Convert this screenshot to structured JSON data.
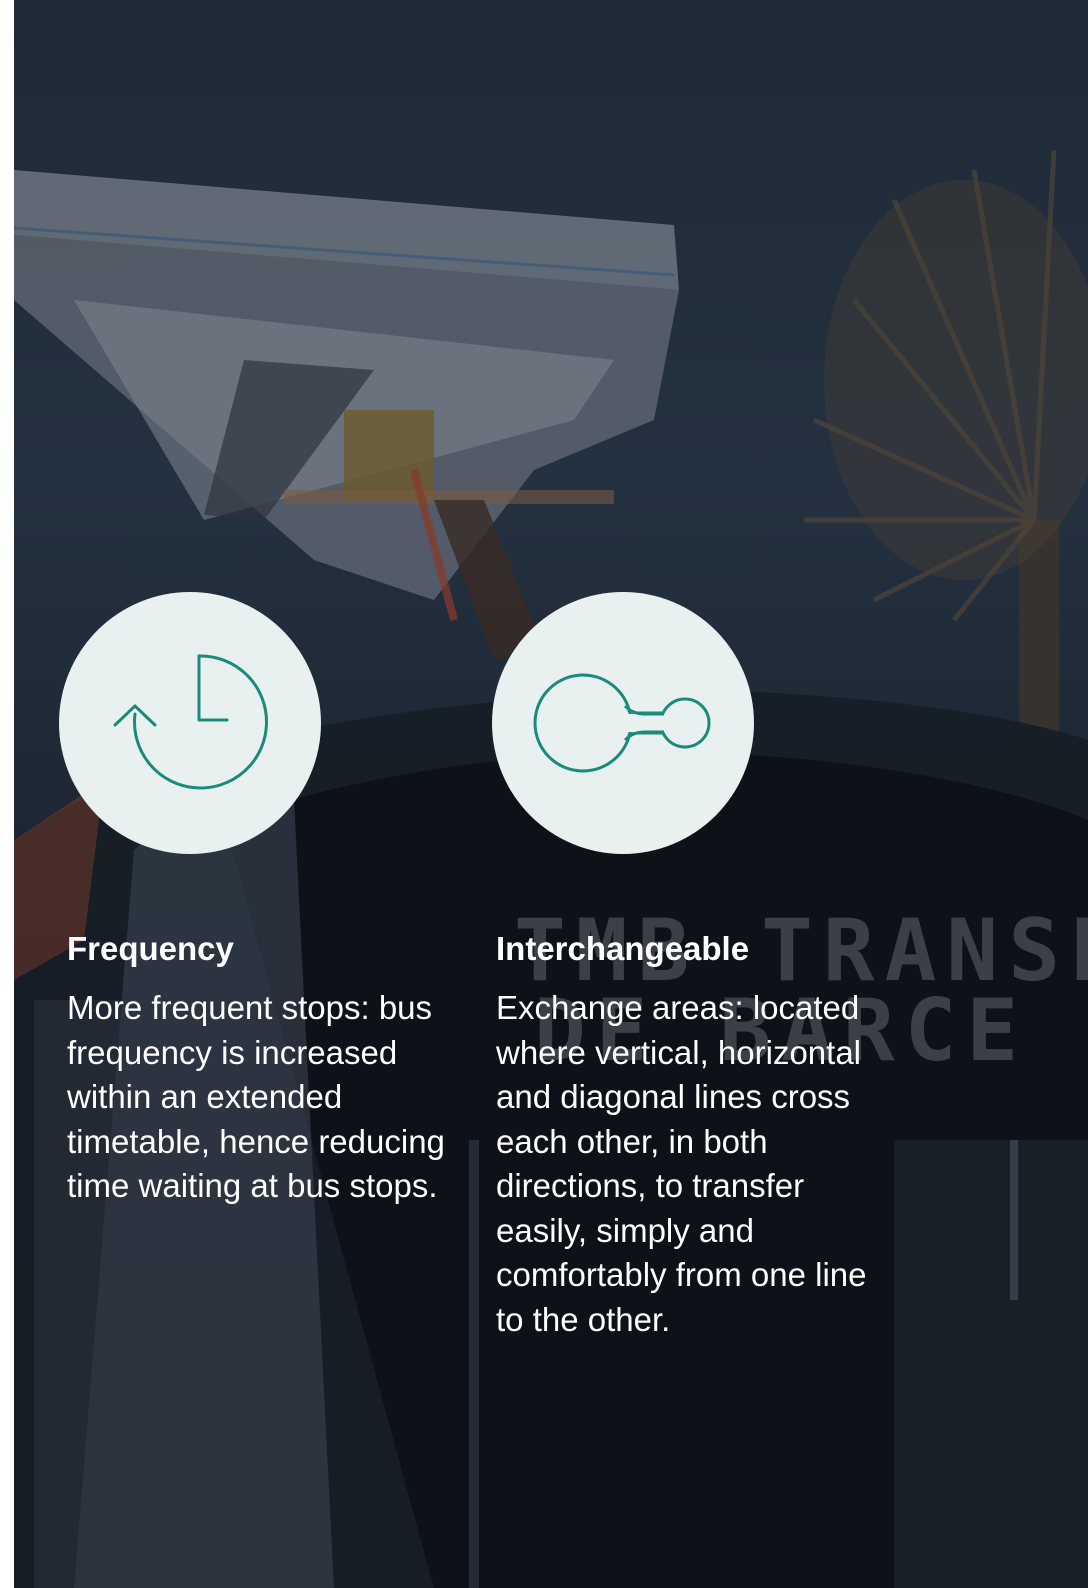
{
  "features": [
    {
      "icon": "clock-refresh-icon",
      "title": "Frequency",
      "text": "More frequent stops: bus frequency is increased within an extended timetable, hence reducing time waiting at bus stops."
    },
    {
      "icon": "interchange-connector-icon",
      "title": "Interchangeable",
      "text": "Exchange areas: located where vertical, horizontal and diagonal lines cross each other, in both directions, to transfer easily, simply and comfortably from one line to the other."
    }
  ],
  "colors": {
    "icon_background": "#e8f1ef",
    "icon_stroke": "#1a8a7a",
    "text": "#ffffff",
    "overlay": "#1f2a36"
  }
}
